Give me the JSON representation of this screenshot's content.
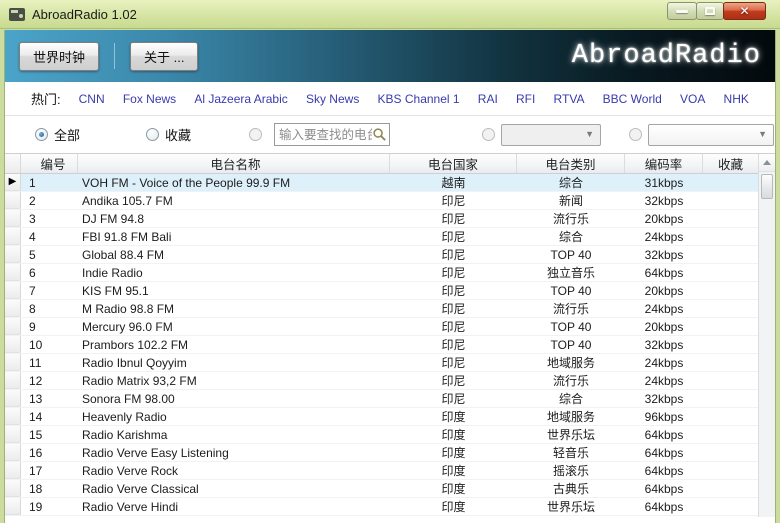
{
  "window": {
    "title": "AbroadRadio 1.02",
    "controls": {
      "minimize": "minimize",
      "maximize": "maximize",
      "close": "✕"
    }
  },
  "banner": {
    "world_clock_label": "世界时钟",
    "about_label": "关于 ...",
    "brand": "AbroadRadio"
  },
  "hot": {
    "label": "热门:",
    "links": [
      "CNN",
      "Fox News",
      "Al Jazeera Arabic",
      "Sky News",
      "KBS Channel 1",
      "RAI",
      "RFI",
      "RTVA",
      "BBC World",
      "VOA",
      "NHK"
    ]
  },
  "filters": {
    "all_label": "全部",
    "favorites_label": "收藏",
    "search_placeholder": "输入要查找的电台名",
    "country_dropdown_value": "",
    "category_dropdown_value": ""
  },
  "table": {
    "columns": [
      "编号",
      "电台名称",
      "电台国家",
      "电台类别",
      "编码率",
      "收藏"
    ],
    "selected_index": 0,
    "selection_marker": "▶",
    "rows": [
      {
        "no": "1",
        "name": "VOH FM - Voice of the People 99.9 FM",
        "country": "越南",
        "category": "综合",
        "bitrate": "31kbps",
        "fav": ""
      },
      {
        "no": "2",
        "name": "Andika 105.7 FM",
        "country": "印尼",
        "category": "新闻",
        "bitrate": "32kbps",
        "fav": ""
      },
      {
        "no": "3",
        "name": "DJ FM 94.8",
        "country": "印尼",
        "category": "流行乐",
        "bitrate": "20kbps",
        "fav": ""
      },
      {
        "no": "4",
        "name": "FBI 91.8 FM Bali",
        "country": "印尼",
        "category": "综合",
        "bitrate": "24kbps",
        "fav": ""
      },
      {
        "no": "5",
        "name": "Global 88.4 FM",
        "country": "印尼",
        "category": "TOP 40",
        "bitrate": "32kbps",
        "fav": ""
      },
      {
        "no": "6",
        "name": "Indie Radio",
        "country": "印尼",
        "category": "独立音乐",
        "bitrate": "64kbps",
        "fav": ""
      },
      {
        "no": "7",
        "name": "KIS FM 95.1",
        "country": "印尼",
        "category": "TOP 40",
        "bitrate": "20kbps",
        "fav": ""
      },
      {
        "no": "8",
        "name": "M Radio 98.8 FM",
        "country": "印尼",
        "category": "流行乐",
        "bitrate": "24kbps",
        "fav": ""
      },
      {
        "no": "9",
        "name": "Mercury 96.0 FM",
        "country": "印尼",
        "category": "TOP 40",
        "bitrate": "20kbps",
        "fav": ""
      },
      {
        "no": "10",
        "name": "Prambors 102.2 FM",
        "country": "印尼",
        "category": "TOP 40",
        "bitrate": "32kbps",
        "fav": ""
      },
      {
        "no": "11",
        "name": "Radio Ibnul Qoyyim",
        "country": "印尼",
        "category": "地域服务",
        "bitrate": "24kbps",
        "fav": ""
      },
      {
        "no": "12",
        "name": "Radio Matrix 93,2 FM",
        "country": "印尼",
        "category": "流行乐",
        "bitrate": "24kbps",
        "fav": ""
      },
      {
        "no": "13",
        "name": "Sonora FM 98.00",
        "country": "印尼",
        "category": "综合",
        "bitrate": "32kbps",
        "fav": ""
      },
      {
        "no": "14",
        "name": "Heavenly Radio",
        "country": "印度",
        "category": "地域服务",
        "bitrate": "96kbps",
        "fav": ""
      },
      {
        "no": "15",
        "name": "Radio Karishma",
        "country": "印度",
        "category": "世界乐坛",
        "bitrate": "64kbps",
        "fav": ""
      },
      {
        "no": "16",
        "name": "Radio Verve Easy Listening",
        "country": "印度",
        "category": "轻音乐",
        "bitrate": "64kbps",
        "fav": ""
      },
      {
        "no": "17",
        "name": "Radio Verve Rock",
        "country": "印度",
        "category": "摇滚乐",
        "bitrate": "64kbps",
        "fav": ""
      },
      {
        "no": "18",
        "name": "Radio Verve Classical",
        "country": "印度",
        "category": "古典乐",
        "bitrate": "64kbps",
        "fav": ""
      },
      {
        "no": "19",
        "name": "Radio Verve Hindi",
        "country": "印度",
        "category": "世界乐坛",
        "bitrate": "64kbps",
        "fav": ""
      }
    ]
  },
  "colors": {
    "titlebar_green": "#d5e4a2",
    "frame_green": "#cbdc9c",
    "banner_left_blue": "#4ba4c9",
    "banner_right_dark": "#03090d",
    "link_blue": "#3a3aae",
    "selected_row_blue": "#def0fa",
    "close_button_red": "#c23c1f",
    "radio_checked_blue": "#1b5d9b"
  }
}
